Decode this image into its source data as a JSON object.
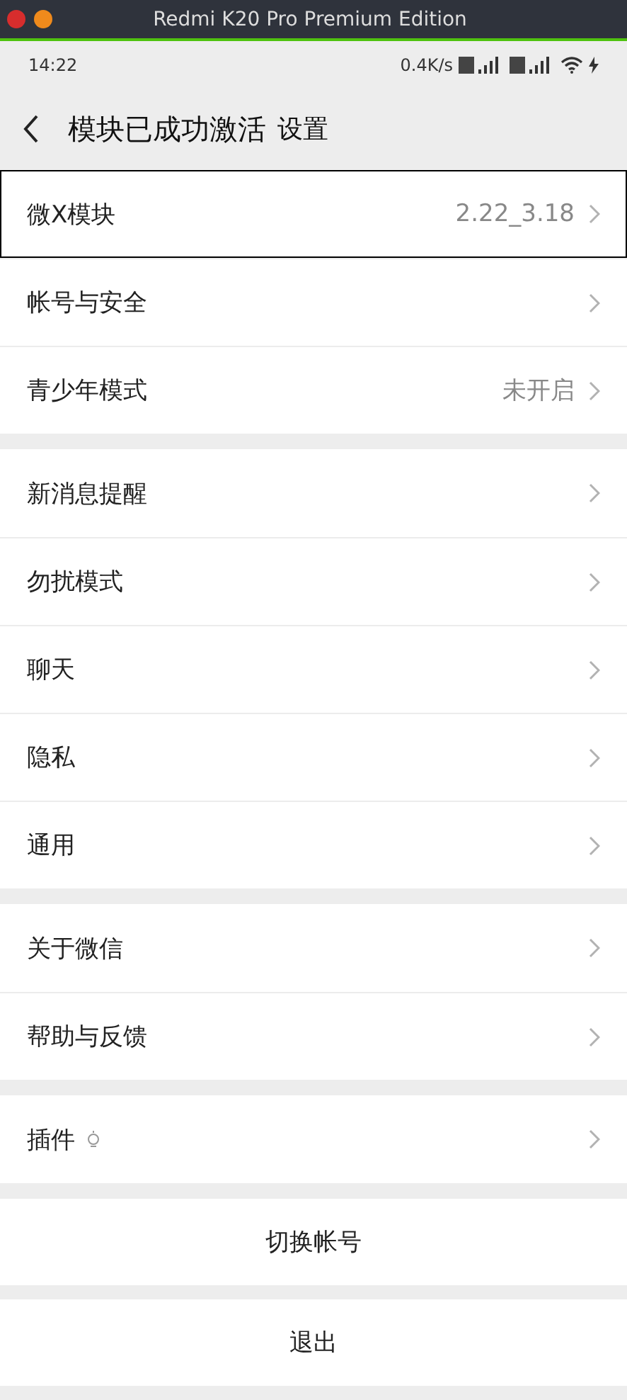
{
  "window": {
    "title": "Redmi K20 Pro Premium Edition"
  },
  "status_bar": {
    "time": "14:22",
    "network_speed": "0.4K/s"
  },
  "header": {
    "title": "模块已成功激活",
    "subtitle": "设置"
  },
  "groups": [
    {
      "items": [
        {
          "kind": "link",
          "label": "微X模块",
          "value": "2.22_3.18",
          "selected": true
        },
        {
          "kind": "link",
          "label": "帐号与安全",
          "selected": false
        },
        {
          "kind": "link",
          "label": "青少年模式",
          "value": "未开启",
          "selected": false
        }
      ]
    },
    {
      "items": [
        {
          "kind": "link",
          "label": "新消息提醒",
          "selected": false
        },
        {
          "kind": "link",
          "label": "勿扰模式",
          "selected": false
        },
        {
          "kind": "link",
          "label": "聊天",
          "selected": false
        },
        {
          "kind": "link",
          "label": "隐私",
          "selected": false
        },
        {
          "kind": "link",
          "label": "通用",
          "selected": false
        }
      ]
    },
    {
      "items": [
        {
          "kind": "link",
          "label": "关于微信",
          "selected": false
        },
        {
          "kind": "link",
          "label": "帮助与反馈",
          "selected": false
        }
      ]
    },
    {
      "items": [
        {
          "kind": "plugin",
          "label": "插件",
          "selected": false
        }
      ]
    }
  ],
  "actions": [
    "切换帐号",
    "退出"
  ]
}
